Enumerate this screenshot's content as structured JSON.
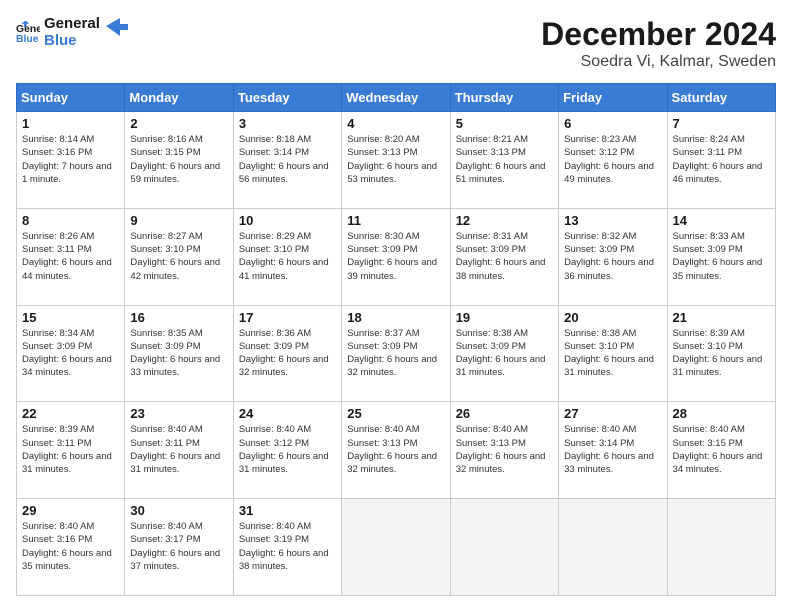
{
  "header": {
    "logo_general": "General",
    "logo_blue": "Blue",
    "month": "December 2024",
    "location": "Soedra Vi, Kalmar, Sweden"
  },
  "days_of_week": [
    "Sunday",
    "Monday",
    "Tuesday",
    "Wednesday",
    "Thursday",
    "Friday",
    "Saturday"
  ],
  "weeks": [
    [
      {
        "num": "1",
        "sunrise": "8:14 AM",
        "sunset": "3:16 PM",
        "daylight": "7 hours and 1 minute."
      },
      {
        "num": "2",
        "sunrise": "8:16 AM",
        "sunset": "3:15 PM",
        "daylight": "6 hours and 59 minutes."
      },
      {
        "num": "3",
        "sunrise": "8:18 AM",
        "sunset": "3:14 PM",
        "daylight": "6 hours and 56 minutes."
      },
      {
        "num": "4",
        "sunrise": "8:20 AM",
        "sunset": "3:13 PM",
        "daylight": "6 hours and 53 minutes."
      },
      {
        "num": "5",
        "sunrise": "8:21 AM",
        "sunset": "3:13 PM",
        "daylight": "6 hours and 51 minutes."
      },
      {
        "num": "6",
        "sunrise": "8:23 AM",
        "sunset": "3:12 PM",
        "daylight": "6 hours and 49 minutes."
      },
      {
        "num": "7",
        "sunrise": "8:24 AM",
        "sunset": "3:11 PM",
        "daylight": "6 hours and 46 minutes."
      }
    ],
    [
      {
        "num": "8",
        "sunrise": "8:26 AM",
        "sunset": "3:11 PM",
        "daylight": "6 hours and 44 minutes."
      },
      {
        "num": "9",
        "sunrise": "8:27 AM",
        "sunset": "3:10 PM",
        "daylight": "6 hours and 42 minutes."
      },
      {
        "num": "10",
        "sunrise": "8:29 AM",
        "sunset": "3:10 PM",
        "daylight": "6 hours and 41 minutes."
      },
      {
        "num": "11",
        "sunrise": "8:30 AM",
        "sunset": "3:09 PM",
        "daylight": "6 hours and 39 minutes."
      },
      {
        "num": "12",
        "sunrise": "8:31 AM",
        "sunset": "3:09 PM",
        "daylight": "6 hours and 38 minutes."
      },
      {
        "num": "13",
        "sunrise": "8:32 AM",
        "sunset": "3:09 PM",
        "daylight": "6 hours and 36 minutes."
      },
      {
        "num": "14",
        "sunrise": "8:33 AM",
        "sunset": "3:09 PM",
        "daylight": "6 hours and 35 minutes."
      }
    ],
    [
      {
        "num": "15",
        "sunrise": "8:34 AM",
        "sunset": "3:09 PM",
        "daylight": "6 hours and 34 minutes."
      },
      {
        "num": "16",
        "sunrise": "8:35 AM",
        "sunset": "3:09 PM",
        "daylight": "6 hours and 33 minutes."
      },
      {
        "num": "17",
        "sunrise": "8:36 AM",
        "sunset": "3:09 PM",
        "daylight": "6 hours and 32 minutes."
      },
      {
        "num": "18",
        "sunrise": "8:37 AM",
        "sunset": "3:09 PM",
        "daylight": "6 hours and 32 minutes."
      },
      {
        "num": "19",
        "sunrise": "8:38 AM",
        "sunset": "3:09 PM",
        "daylight": "6 hours and 31 minutes."
      },
      {
        "num": "20",
        "sunrise": "8:38 AM",
        "sunset": "3:10 PM",
        "daylight": "6 hours and 31 minutes."
      },
      {
        "num": "21",
        "sunrise": "8:39 AM",
        "sunset": "3:10 PM",
        "daylight": "6 hours and 31 minutes."
      }
    ],
    [
      {
        "num": "22",
        "sunrise": "8:39 AM",
        "sunset": "3:11 PM",
        "daylight": "6 hours and 31 minutes."
      },
      {
        "num": "23",
        "sunrise": "8:40 AM",
        "sunset": "3:11 PM",
        "daylight": "6 hours and 31 minutes."
      },
      {
        "num": "24",
        "sunrise": "8:40 AM",
        "sunset": "3:12 PM",
        "daylight": "6 hours and 31 minutes."
      },
      {
        "num": "25",
        "sunrise": "8:40 AM",
        "sunset": "3:13 PM",
        "daylight": "6 hours and 32 minutes."
      },
      {
        "num": "26",
        "sunrise": "8:40 AM",
        "sunset": "3:13 PM",
        "daylight": "6 hours and 32 minutes."
      },
      {
        "num": "27",
        "sunrise": "8:40 AM",
        "sunset": "3:14 PM",
        "daylight": "6 hours and 33 minutes."
      },
      {
        "num": "28",
        "sunrise": "8:40 AM",
        "sunset": "3:15 PM",
        "daylight": "6 hours and 34 minutes."
      }
    ],
    [
      {
        "num": "29",
        "sunrise": "8:40 AM",
        "sunset": "3:16 PM",
        "daylight": "6 hours and 35 minutes."
      },
      {
        "num": "30",
        "sunrise": "8:40 AM",
        "sunset": "3:17 PM",
        "daylight": "6 hours and 37 minutes."
      },
      {
        "num": "31",
        "sunrise": "8:40 AM",
        "sunset": "3:19 PM",
        "daylight": "6 hours and 38 minutes."
      },
      null,
      null,
      null,
      null
    ]
  ]
}
